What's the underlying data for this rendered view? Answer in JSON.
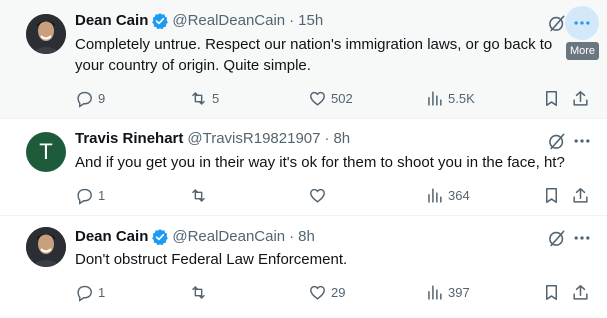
{
  "tweets": [
    {
      "author_name": "Dean Cain",
      "author_handle": "@RealDeanCain",
      "separator": "·",
      "time": "15h",
      "text": "Completely untrue.  Respect our nation's immigration laws, or go back to your country of origin. Quite simple.",
      "verified": true,
      "replies": "9",
      "retweets": "5",
      "likes": "502",
      "views": "5.5K",
      "more_tooltip": "More"
    },
    {
      "author_name": "Travis Rinehart",
      "author_handle": "@TravisR19821907",
      "separator": "·",
      "time": "8h",
      "avatar_letter": "T",
      "text": "And if you get you in their way it's ok for them to shoot you in the face, ht?",
      "verified": false,
      "replies": "1",
      "retweets": "",
      "likes": "",
      "views": "364"
    },
    {
      "author_name": "Dean Cain",
      "author_handle": "@RealDeanCain",
      "separator": "·",
      "time": "8h",
      "text": "Don't obstruct Federal Law Enforcement.",
      "verified": true,
      "replies": "1",
      "retweets": "",
      "likes": "29",
      "views": "397"
    }
  ],
  "colors": {
    "verified_badge": "#1d9bf0",
    "secondary_text": "#536471",
    "highlight_bg": "#f7f9f9",
    "more_hover": "#d3e8f8"
  },
  "icons": [
    "grok-icon",
    "more-icon",
    "reply-icon",
    "retweet-icon",
    "like-icon",
    "views-icon",
    "bookmark-icon",
    "share-icon",
    "verified-icon"
  ]
}
